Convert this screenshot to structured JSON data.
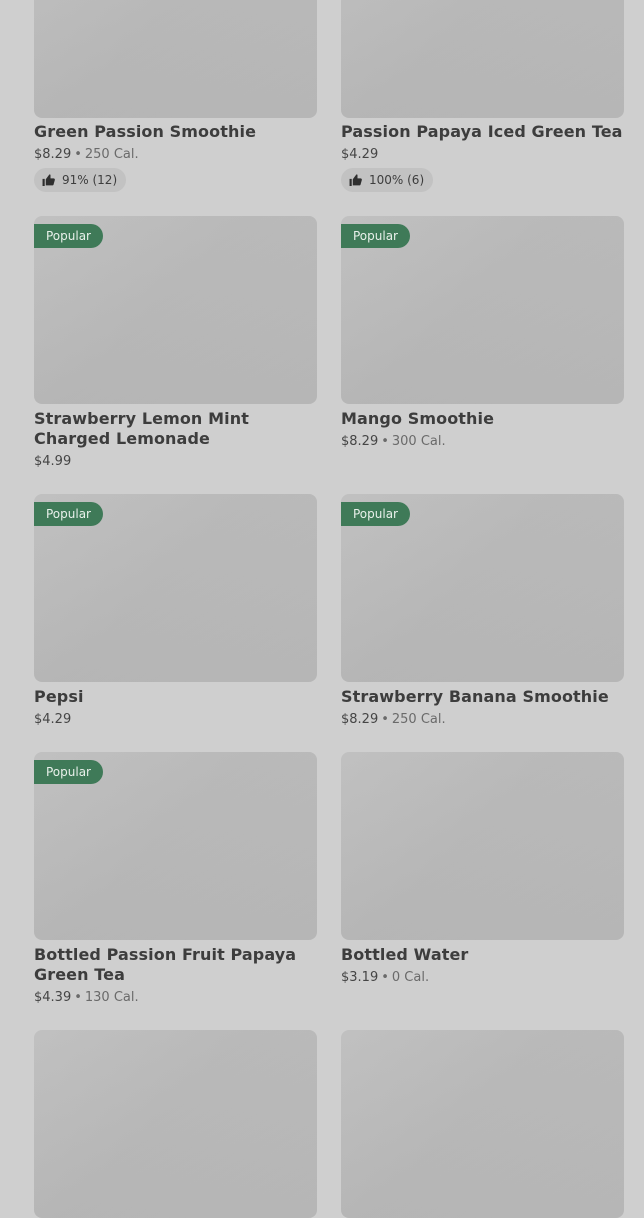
{
  "items": [
    {
      "name": "Green Passion Smoothie",
      "price": "$8.29",
      "calories": "250 Cal.",
      "rating": "91% (12)",
      "popular": ""
    },
    {
      "name": "Passion Papaya Iced Green Tea",
      "price": "$4.29",
      "calories": "",
      "rating": "100% (6)",
      "popular": ""
    },
    {
      "name": "Strawberry Lemon Mint Charged Lemonade",
      "price": "$4.99",
      "calories": "",
      "rating": "",
      "popular": "Popular"
    },
    {
      "name": "Mango Smoothie",
      "price": "$8.29",
      "calories": "300 Cal.",
      "rating": "",
      "popular": "Popular"
    },
    {
      "name": "Pepsi",
      "price": "$4.29",
      "calories": "",
      "rating": "",
      "popular": "Popular"
    },
    {
      "name": "Strawberry Banana Smoothie",
      "price": "$8.29",
      "calories": "250 Cal.",
      "rating": "",
      "popular": "Popular"
    },
    {
      "name": "Bottled Passion Fruit Papaya Green Tea",
      "price": "$4.39",
      "calories": "130 Cal.",
      "rating": "",
      "popular": "Popular"
    },
    {
      "name": "Bottled Water",
      "price": "$3.19",
      "calories": "0 Cal.",
      "rating": "",
      "popular": ""
    }
  ],
  "colors": {
    "page_background": "#cfcfcf",
    "badge_background": "#3f7a58",
    "image_placeholder": "#bcbcbc"
  }
}
